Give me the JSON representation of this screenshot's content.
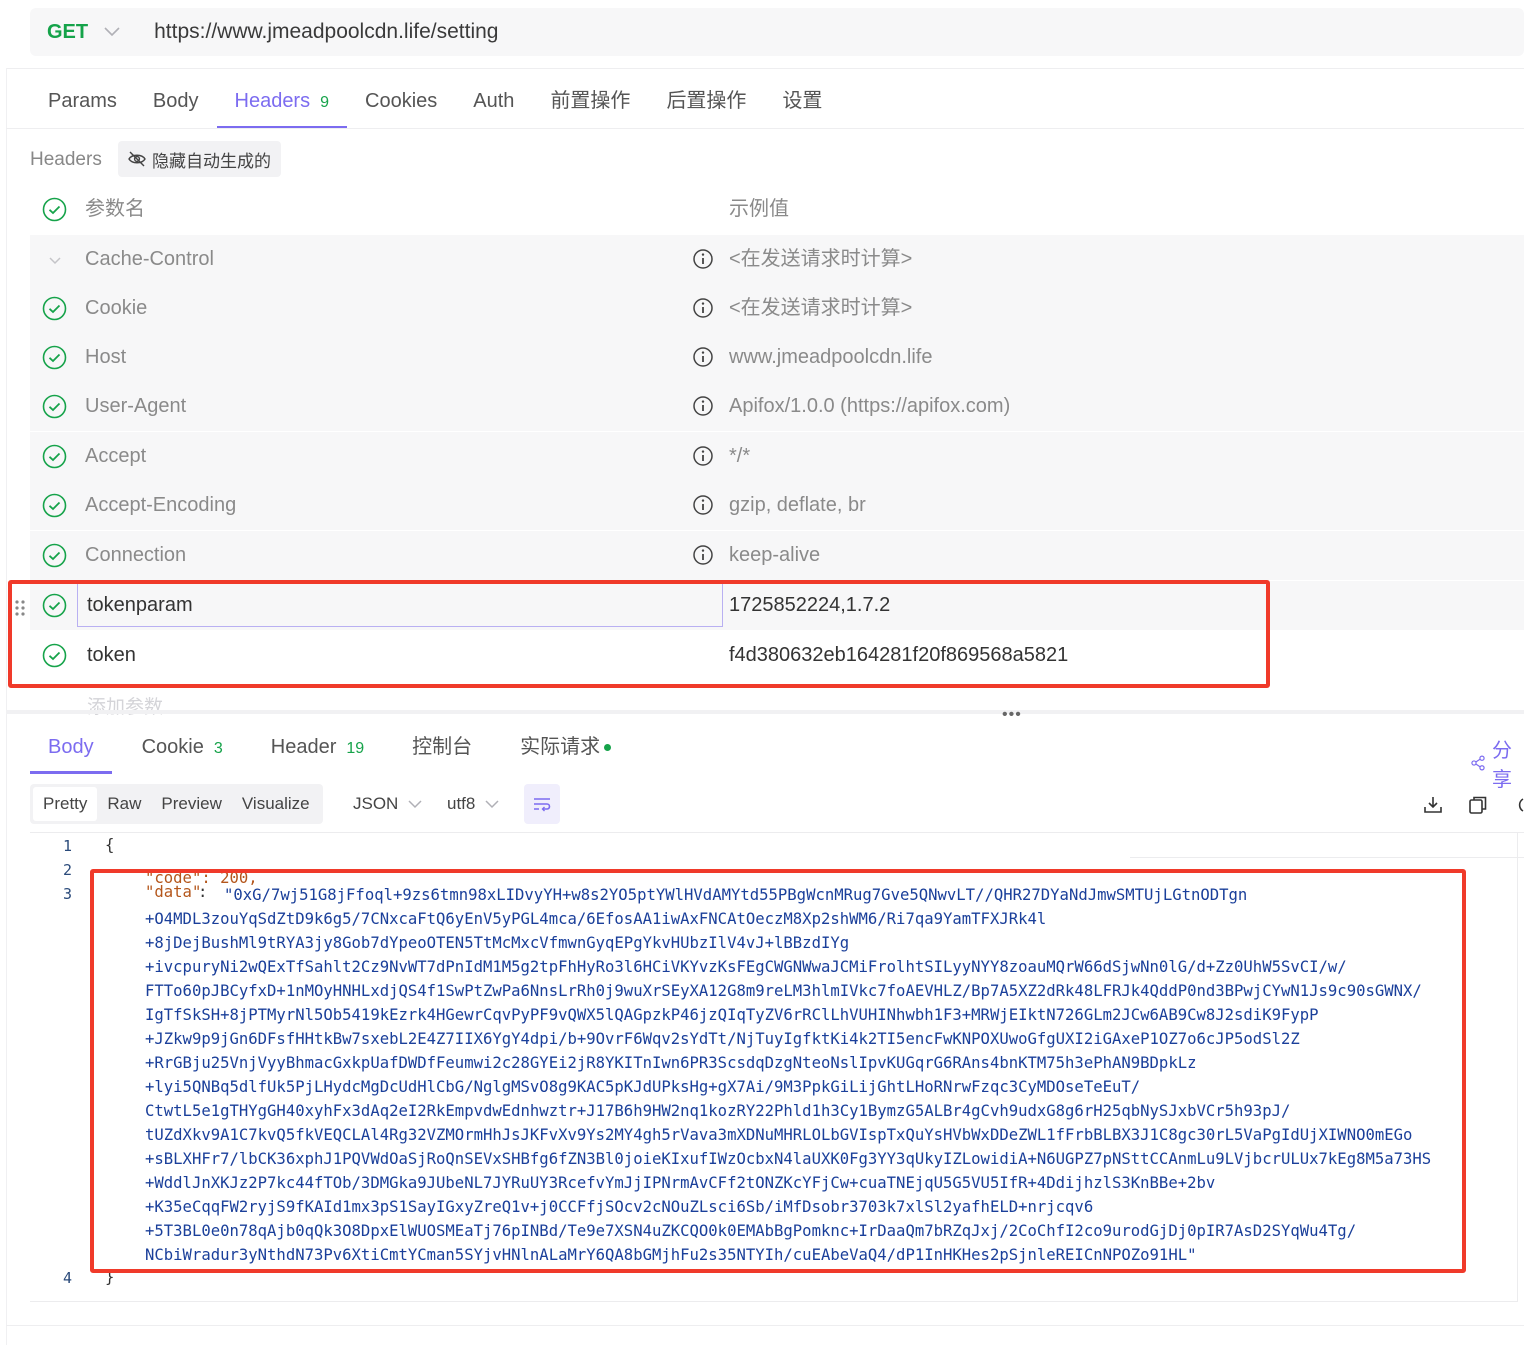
{
  "request": {
    "method": "GET",
    "url": "https://www.jmeadpoolcdn.life/setting"
  },
  "req_tabs": [
    {
      "label": "Params",
      "count": ""
    },
    {
      "label": "Body",
      "count": ""
    },
    {
      "label": "Headers",
      "count": "9"
    },
    {
      "label": "Cookies",
      "count": ""
    },
    {
      "label": "Auth",
      "count": ""
    },
    {
      "label": "前置操作",
      "count": ""
    },
    {
      "label": "后置操作",
      "count": ""
    },
    {
      "label": "设置",
      "count": ""
    }
  ],
  "headers_section": {
    "label": "Headers",
    "hide_auto_label": "隐藏自动生成的",
    "col_name": "参数名",
    "col_value": "示例值",
    "rows": [
      {
        "name": "Cache-Control",
        "value": "<在发送请求时计算>"
      },
      {
        "name": "Cookie",
        "value": "<在发送请求时计算>"
      },
      {
        "name": "Host",
        "value": "www.jmeadpoolcdn.life"
      },
      {
        "name": "User-Agent",
        "value": "Apifox/1.0.0 (https://apifox.com)"
      },
      {
        "name": "Accept",
        "value": "*/*"
      },
      {
        "name": "Accept-Encoding",
        "value": "gzip, deflate, br"
      },
      {
        "name": "Connection",
        "value": "keep-alive"
      }
    ],
    "custom_rows": [
      {
        "name": "tokenparam",
        "value": "1725852224,1.7.2"
      },
      {
        "name": "token",
        "value": "f4d380632eb164281f20f869568a5821"
      }
    ],
    "add_param": "添加参数"
  },
  "res_tabs": [
    {
      "label": "Body",
      "count": ""
    },
    {
      "label": "Cookie",
      "count": "3"
    },
    {
      "label": "Header",
      "count": "19"
    },
    {
      "label": "控制台",
      "count": ""
    },
    {
      "label": "实际请求",
      "count": ""
    }
  ],
  "share_label": "分享",
  "format": {
    "modes": [
      "Pretty",
      "Raw",
      "Preview",
      "Visualize"
    ],
    "language": "JSON",
    "encoding": "utf8"
  },
  "code": {
    "line_numbers": [
      "1",
      "2",
      "3",
      "4"
    ],
    "open_brace": "{",
    "close_brace": "}",
    "code_line": "\"code\": 200,",
    "data_key": "\"data\"",
    "data_lines": [
      "\"0xG/7wj51G8jFfoql+9zs6tmn98xLIDvyYH+w8s2YO5ptYWlHVdAMYtd55PBgWcnMRug7Gve5QNwvLT//QHR27DYaNdJmwSMTUjLGtnODTgn",
      "+O4MDL3zouYqSdZtD9k6g5/7CNxcaFtQ6yEnV5yPGL4mca/6EfosAA1iwAxFNCAtOeczM8Xp2shWM6/Ri7qa9YamTFXJRk4l",
      "+8jDejBushMl9tRYA3jy8Gob7dYpeoOTEN5TtMcMxcVfmwnGyqEPgYkvHUbzIlV4vJ+lBBzdIYg",
      "+ivcpuryNi2wQExTfSahlt2Cz9NvWT7dPnIdM1M5g2tpFhHyRo3l6HCiVKYvzKsFEgCWGNWwaJCMiFrolhtSILyyNYY8zoauMQrW66dSjwNn0lG/d+Zz0UhW5SvCI/w/",
      "FTTo60pJBCyfxD+1nMOyHNHLxdjQS4f1SwPtZwPa6NnsLrRh0j9wuXrSEyXA12G8m9reLM3hlmIVkc7foAEVHLZ/Bp7A5XZ2dRk48LFRJk4QddP0nd3BPwjCYwN1Js9c90sGWNX/",
      "IgTfSkSH+8jPTMyrNl5Ob5419kEzrk4HGewrCqvPyPF9vQWX5lQAGpzkP46jzQIqTyZV6rRClLhVUHINhwbh1F3+MRWjEIktN726GLm2JCw6AB9Cw8J2sdiK9FypP",
      "+JZkw9p9jGn6DFsfHHtkBw7sxebL2E4Z7IIX6YgY4dpi/b+9OvrF6Wqv2sYdTt/NjTuyIgfktKi4k2TI5encFwKNPOXUwoGfgUXI2iGAxeP1OZ7o6cJP5odSl2Z",
      "+RrGBju25VnjVyyBhmacGxkpUafDWDfFeumwi2c28GYEi2jR8YKITnIwn6PR3ScsdqDzgNteoNslIpvKUGqrG6RAns4bnKTM75h3ePhAN9BDpkLz",
      "+lyi5QNBq5dlfUk5PjLHydcMgDcUdHlCbG/NglgMSvO8g9KAC5pKJdUPksHg+gX7Ai/9M3PpkGiLijGhtLHoRNrwFzqc3CyMDOseTeEuT/",
      "CtwtL5e1gTHYgGH40xyhFx3dAq2eI2RkEmpvdwEdnhwztr+J17B6h9HW2nq1kozRY22Phld1h3Cy1BymzG5ALBr4gCvh9udxG8g6rH25qbNySJxbVCr5h93pJ/",
      "tUZdXkv9A1C7kvQ5fkVEQCLAl4Rg32VZMOrmHhJsJKFvXv9Ys2MY4gh5rVava3mXDNuMHRLOLbGVIspTxQuYsHVbWxDDeZWL1fFrbBLBX3J1C8gc30rL5VaPgIdUjXIWNO0mEGo",
      "+sBLXHFr7/lbCK36xphJ1PQVWdOaSjRoQnSEVxSHBfg6fZN3Bl0joieKIxufIWzOcbxN4laUXK0Fg3YY3qUkyIZLowidiA+N6UGPZ7pNSttCCAnmLu9LVjbcrULUx7kEg8M5a73HS",
      "+WddlJnXKJz2P7kc44fTOb/3DMGka9JUbeNL7JYRuUY3RcefvYmJjIPNrmAvCFf2tONZKcYFjCw+cuaTNEjqU5G5VU5IfR+4DdijhzlS3KnBBe+2bv",
      "+K35eCqqFW2ryjS9fKAId1mx3pS1SayIGxyZreQ1v+j0CCFfjSOcv2cNOuZLsci6Sb/iMfDsobr3703k7xlSl2yafhELD+nrjcqv6",
      "+5T3BL0e0n78qAjb0qQk3O8DpxElWUOSMEaTj76pINBd/Te9e7XSN4uZKCQO0k0EMAbBgPomknc+IrDaaQm7bRZqJxj/2CoChfI2co9urodGjDj0pIR7AsD2SYqWu4Tg/",
      "NCbiWradur3yNthdN73Pv6XtiCmtYCman5SYjvHNlnALaMrY6QA8bGMjhFu2s35NTYIh/cuEAbeVaQ4/dP1InHKHes2pSjnleREICnNPOZo91HL\""
    ]
  },
  "colors": {
    "accent": "#7c6cf0",
    "method_green": "#15a34a",
    "highlight_red": "#f03a2a"
  }
}
